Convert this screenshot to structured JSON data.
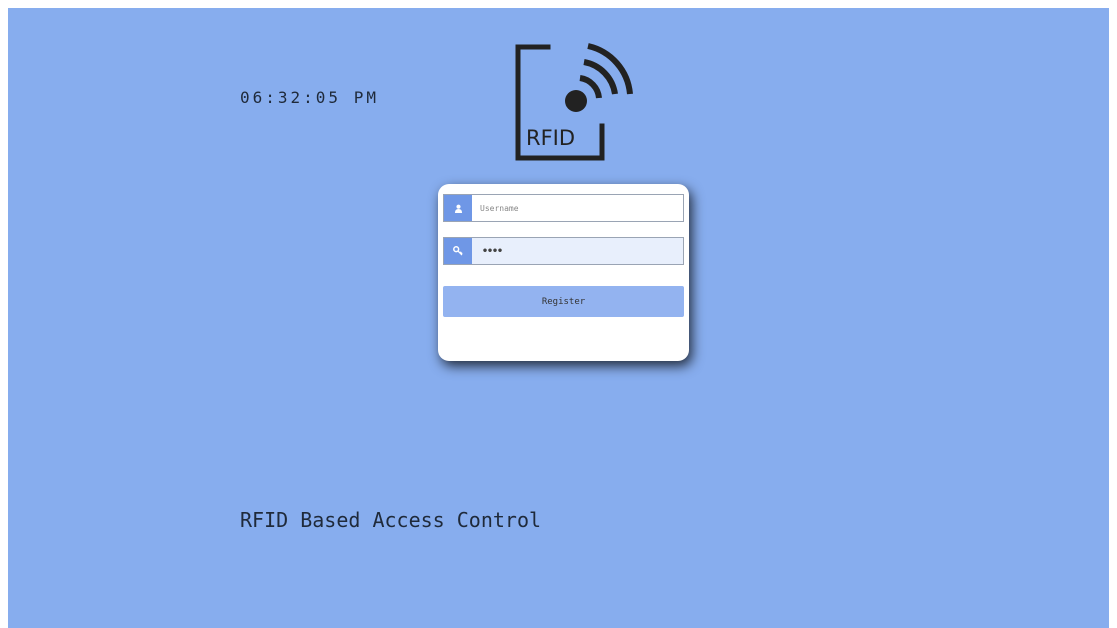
{
  "clock": {
    "time": "06:32:05 PM"
  },
  "logo": {
    "text": "RFID"
  },
  "login_form": {
    "username_placeholder": "Username",
    "password_value": "••••",
    "register_label": "Register"
  },
  "footer": {
    "title": "RFID Based Access Control"
  },
  "colors": {
    "background": "#87adee",
    "icon_accent": "#6f97e6",
    "button": "#93b3f0",
    "card": "#ffffff"
  },
  "icons": {
    "logo": "rfid-logo-icon",
    "username": "user-icon",
    "password": "key-icon"
  }
}
